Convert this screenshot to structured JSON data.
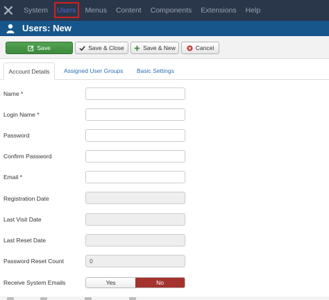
{
  "topnav": {
    "logo": "joomla-logo-icon",
    "items": [
      {
        "label": "System"
      },
      {
        "label": "Users"
      },
      {
        "label": "Menus"
      },
      {
        "label": "Content"
      },
      {
        "label": "Components"
      },
      {
        "label": "Extensions"
      },
      {
        "label": "Help"
      }
    ],
    "active_index": 1,
    "active_color": "#4b67d8",
    "highlight_color": "#d42020"
  },
  "header": {
    "icon": "user-icon",
    "title": "Users: New"
  },
  "toolbar": {
    "save": "Save",
    "save_close": "Save & Close",
    "save_new": "Save & New",
    "cancel": "Cancel"
  },
  "tabs": [
    {
      "label": "Account Details",
      "active": true
    },
    {
      "label": "Assigned User Groups",
      "active": false
    },
    {
      "label": "Basic Settings",
      "active": false
    }
  ],
  "form": {
    "fields": [
      {
        "label": "Name *",
        "value": "",
        "disabled": false
      },
      {
        "label": "Login Name *",
        "value": "",
        "disabled": false
      },
      {
        "label": "Password",
        "value": "",
        "disabled": false
      },
      {
        "label": "Confirm Password",
        "value": "",
        "disabled": false
      },
      {
        "label": "Email *",
        "value": "",
        "disabled": false
      },
      {
        "label": "Registration Date",
        "value": "",
        "disabled": true
      },
      {
        "label": "Last Visit Date",
        "value": "",
        "disabled": true
      },
      {
        "label": "Last Reset Date",
        "value": "",
        "disabled": true
      },
      {
        "label": "Password Reset Count",
        "value": "0",
        "disabled": true
      }
    ],
    "receive_emails": {
      "label": "Receive System Emails",
      "yes": "Yes",
      "no": "No",
      "selected": "No"
    }
  },
  "colors": {
    "nav_bg": "#2a374a",
    "title_bg": "#17568b",
    "save_green": "#46a046",
    "no_red": "#a4332f"
  }
}
